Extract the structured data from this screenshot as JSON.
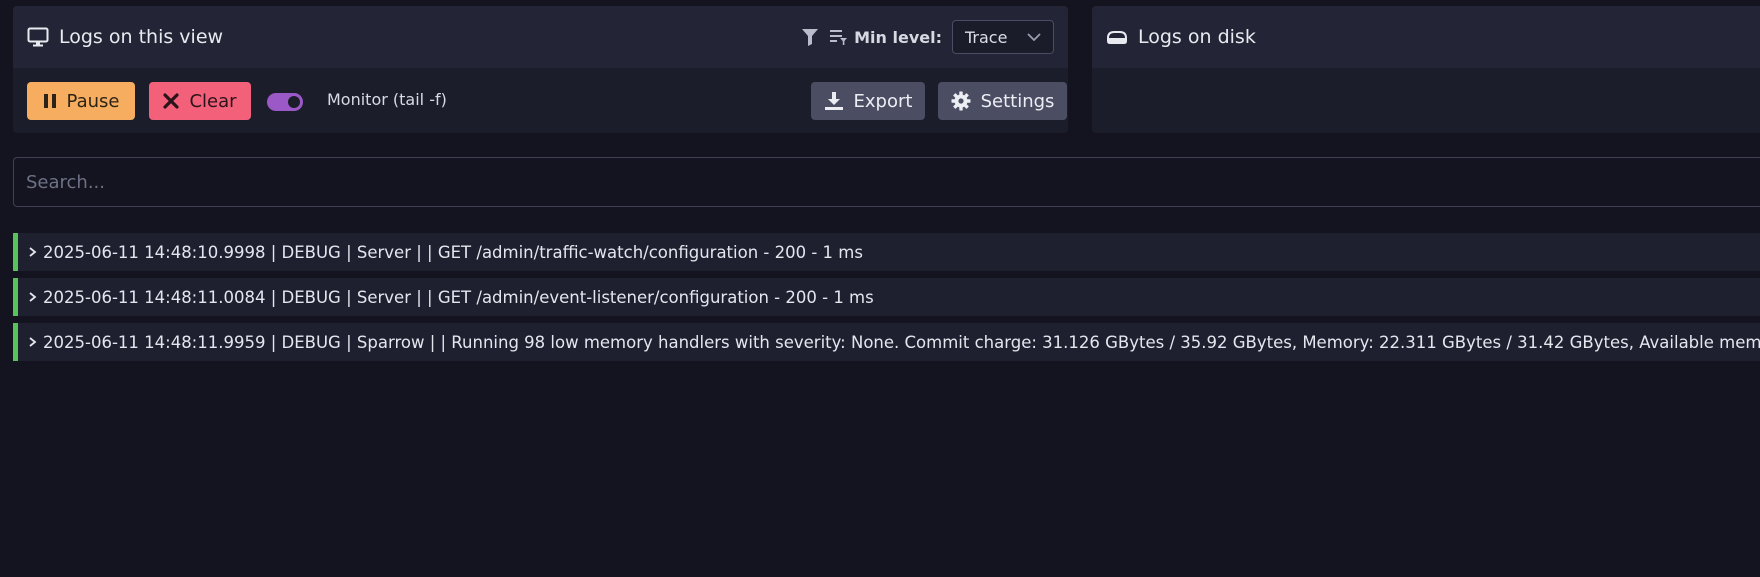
{
  "view_panel": {
    "title": "Logs on this view",
    "min_level_label": "Min level:",
    "min_level_value": "Trace",
    "pause_label": "Pause",
    "clear_label": "Clear",
    "monitor_label": "Monitor (tail -f)",
    "monitor_on": true,
    "export_label": "Export",
    "settings_label": "Settings"
  },
  "disk_panel": {
    "title": "Logs on disk"
  },
  "search": {
    "placeholder": "Search..."
  },
  "logs": [
    {
      "text": "2025-06-11 14:48:10.9998 | DEBUG | Server | | GET /admin/traffic-watch/configuration - 200 - 1 ms"
    },
    {
      "text": "2025-06-11 14:48:11.0084 | DEBUG | Server | | GET /admin/event-listener/configuration - 200 - 1 ms"
    },
    {
      "text": "2025-06-11 14:48:11.9959 | DEBUG | Sparrow | | Running 98 low memory handlers with severity: None. Commit charge: 31.126 GBytes / 35.92 GBytes, Memory: 22.311 GBytes / 31.42 GBytes, Available memory for processing"
    }
  ],
  "colors": {
    "pause": "#f6ad5f",
    "clear": "#f2607a",
    "toggle": "#9b59c8",
    "log_level_debug": "#56c458"
  }
}
